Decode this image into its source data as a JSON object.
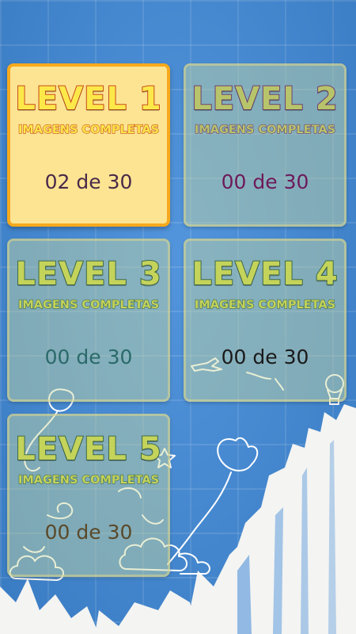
{
  "levels": [
    {
      "title": "LEVEL 1",
      "subtitle": "IMAGENS COMPLETAS",
      "progress": "02 de 30",
      "active": true
    },
    {
      "title": "LEVEL 2",
      "subtitle": "IMAGENS COMPLETAS",
      "progress": "00 de 30",
      "active": false
    },
    {
      "title": "LEVEL 3",
      "subtitle": "IMAGENS COMPLETAS",
      "progress": "00 de 30",
      "active": false
    },
    {
      "title": "LEVEL 4",
      "subtitle": "IMAGENS COMPLETAS",
      "progress": "00 de 30",
      "active": false
    },
    {
      "title": "LEVEL 5",
      "subtitle": "IMAGENS COMPLETAS",
      "progress": "00 de 30",
      "active": false
    }
  ],
  "colors": {
    "background": "#3f89d8",
    "active_card_fill": "#fde492",
    "active_card_border": "#f6a91d",
    "active_title": "#fde84a",
    "inactive_title": "#c4d35a"
  }
}
